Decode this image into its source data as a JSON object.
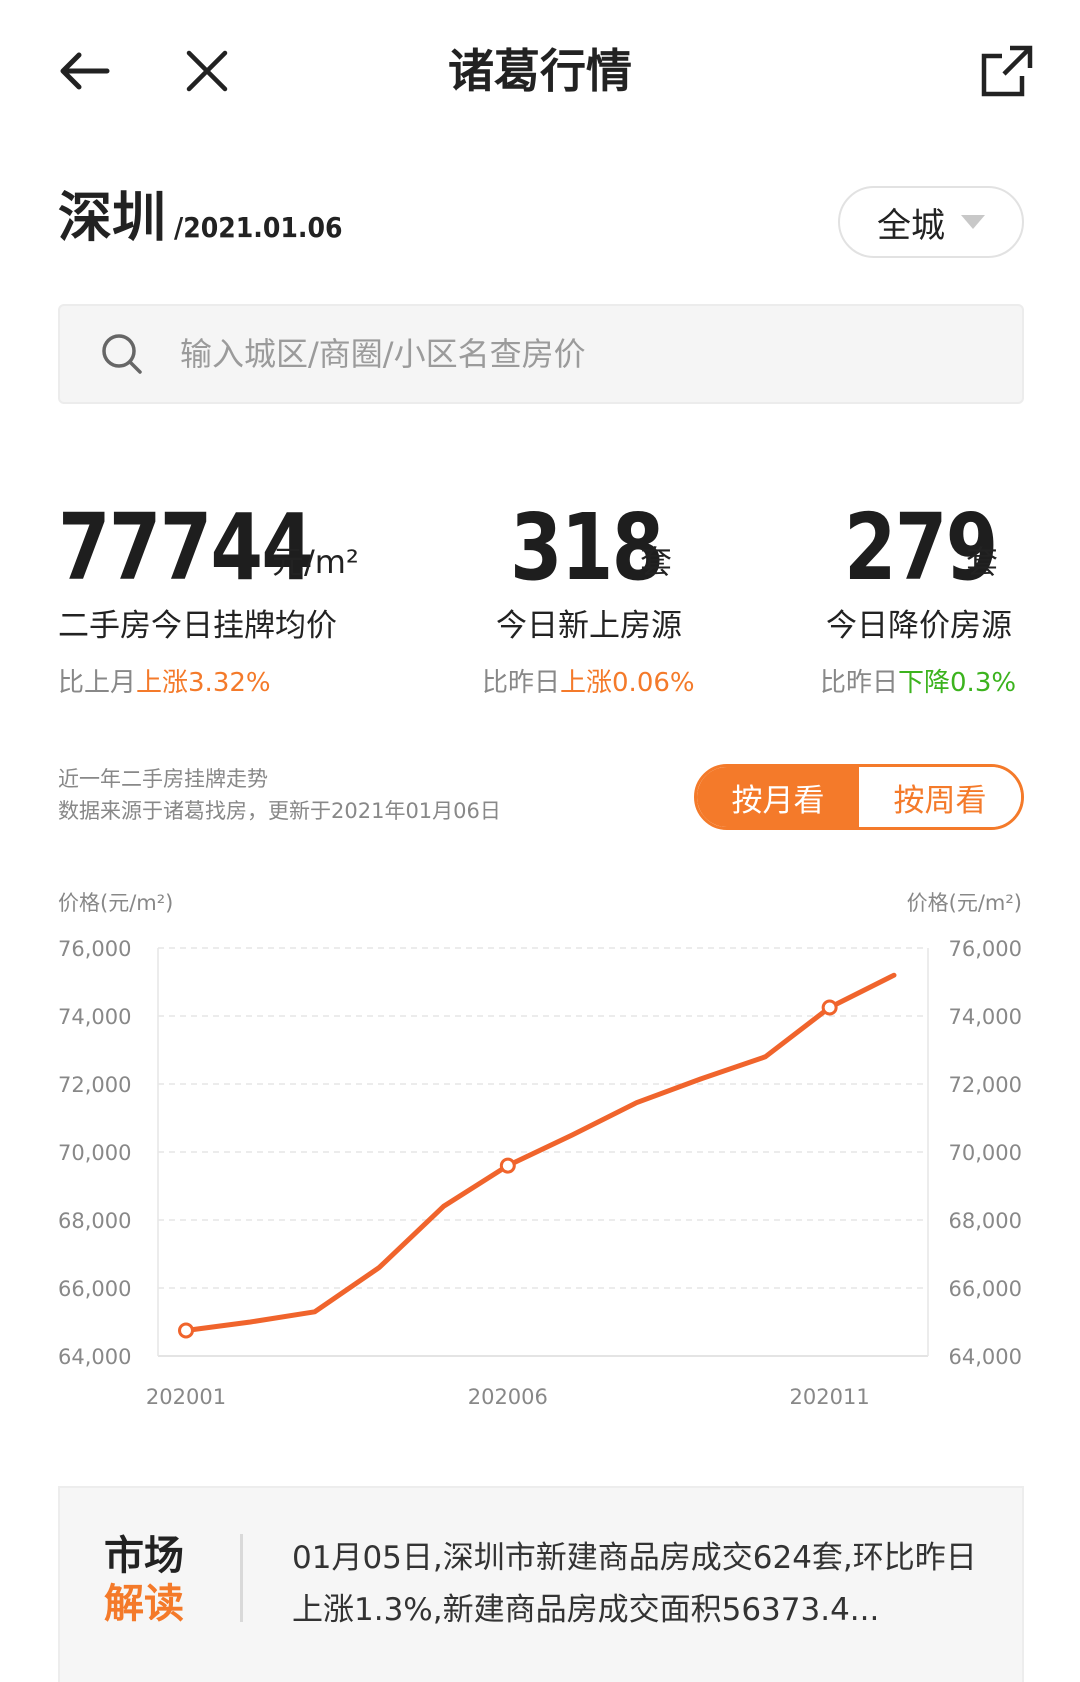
{
  "header": {
    "title": "诸葛行情",
    "back_icon": "arrow-left-icon",
    "close_icon": "close-icon",
    "share_icon": "share-external-icon"
  },
  "location": {
    "city": "深圳",
    "date": "/2021.01.06",
    "district": "全城"
  },
  "search": {
    "placeholder": "输入城区/商圈/小区名查房价"
  },
  "stats": [
    {
      "value": "77744",
      "unit": "元/m²",
      "label": "二手房今日挂牌均价",
      "cmp_prefix": "比上月",
      "cmp_change": "上涨3.32%",
      "direction": "up"
    },
    {
      "value": "318",
      "unit": "套",
      "label": "今日新上房源",
      "cmp_prefix": "比昨日",
      "cmp_change": "上涨0.06%",
      "direction": "up"
    },
    {
      "value": "279",
      "unit": "套",
      "label": "今日降价房源",
      "cmp_prefix": "比昨日",
      "cmp_change": "下降0.3%",
      "direction": "down"
    }
  ],
  "trend": {
    "title": "近一年二手房挂牌走势",
    "source": "数据来源于诸葛找房，更新于2021年01月06日",
    "toggle": [
      "按月看",
      "按周看"
    ],
    "active_index": 0
  },
  "chart_data": {
    "type": "line",
    "ylabel_left": "价格(元/m²)",
    "ylabel_right": "价格(元/m²)",
    "ylim": [
      64000,
      76000
    ],
    "yticks": [
      76000,
      74000,
      72000,
      70000,
      68000,
      66000,
      64000
    ],
    "ytick_labels": [
      "76,000",
      "74,000",
      "72,000",
      "70,000",
      "68,000",
      "66,000",
      "64,000"
    ],
    "x": [
      "202001",
      "202002",
      "202003",
      "202004",
      "202005",
      "202006",
      "202007",
      "202008",
      "202009",
      "202010",
      "202011",
      "202012"
    ],
    "xtick_labels": [
      "202001",
      "202006",
      "202011"
    ],
    "series": [
      {
        "values": [
          64750,
          65000,
          65300,
          66600,
          68400,
          69600,
          70500,
          71450,
          72150,
          72800,
          74250,
          75200
        ]
      }
    ],
    "markers": [
      "202001",
      "202006",
      "202011"
    ],
    "grid": true,
    "color": "#f0642c"
  },
  "market": {
    "logo_line1": "市场",
    "logo_line2": "解读",
    "text": "01月05日,深圳市新建商品房成交624套,环比昨日上涨1.3%,新建商品房成交面积56373.4..."
  },
  "colors": {
    "accent": "#f47a2a",
    "up": "#f47a2a",
    "down": "#3cb31e",
    "line": "#f0642c"
  }
}
